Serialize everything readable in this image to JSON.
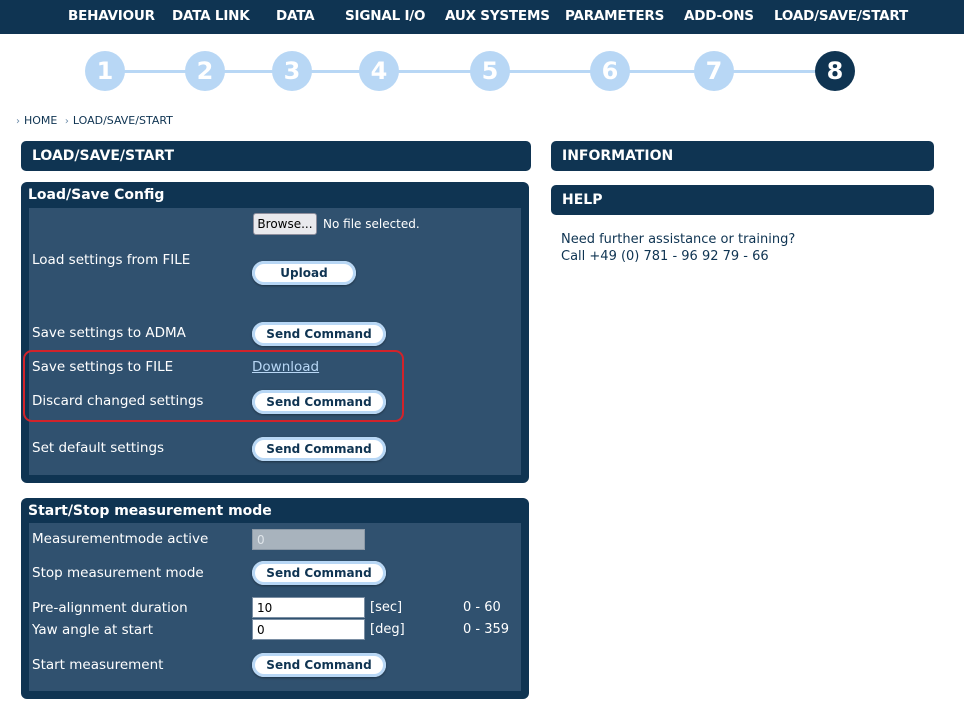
{
  "nav": {
    "items": [
      "BEHAVIOUR",
      "DATA LINK",
      "DATA",
      "SIGNAL I/O",
      "AUX SYSTEMS",
      "PARAMETERS",
      "ADD-ONS",
      "LOAD/SAVE/START"
    ]
  },
  "stepper": {
    "steps": [
      "1",
      "2",
      "3",
      "4",
      "5",
      "6",
      "7",
      "8"
    ],
    "active_step": "8"
  },
  "breadcrumb": {
    "items": [
      "HOME",
      "LOAD/SAVE/START"
    ]
  },
  "left": {
    "section_title": "LOAD/SAVE/START",
    "config": {
      "title": "Load/Save Config",
      "browse_label": "Browse...",
      "no_file_label": "No file selected.",
      "load_file_label": "Load settings from FILE",
      "upload_label": "Upload",
      "save_adma_label": "Save settings to ADMA",
      "save_adma_button": "Send Command",
      "save_file_label": "Save settings to FILE",
      "download_label": "Download",
      "discard_label": "Discard changed settings",
      "discard_button": "Send Command",
      "default_label": "Set default settings",
      "default_button": "Send Command"
    },
    "measurement": {
      "title": "Start/Stop measurement mode",
      "active_label": "Measurementmode active",
      "active_value": "0",
      "stop_label": "Stop measurement mode",
      "stop_button": "Send Command",
      "prealign_label": "Pre-alignment duration",
      "prealign_value": "10",
      "prealign_unit": "[sec]",
      "prealign_range": "0 - 60",
      "yaw_label": "Yaw angle at start",
      "yaw_value": "0",
      "yaw_unit": "[deg]",
      "yaw_range": "0 - 359",
      "start_label": "Start measurement",
      "start_button": "Send Command"
    }
  },
  "right": {
    "info_title": "INFORMATION",
    "help_title": "HELP",
    "help_line1": "Need further assistance or training?",
    "help_line2": "Call +49 (0) 781 - 96 92 79 - 66"
  },
  "colors": {
    "navy": "#0f3452",
    "panel_body": "#30516f",
    "step_inactive": "#b8d7f5",
    "highlight": "#d2232a"
  }
}
